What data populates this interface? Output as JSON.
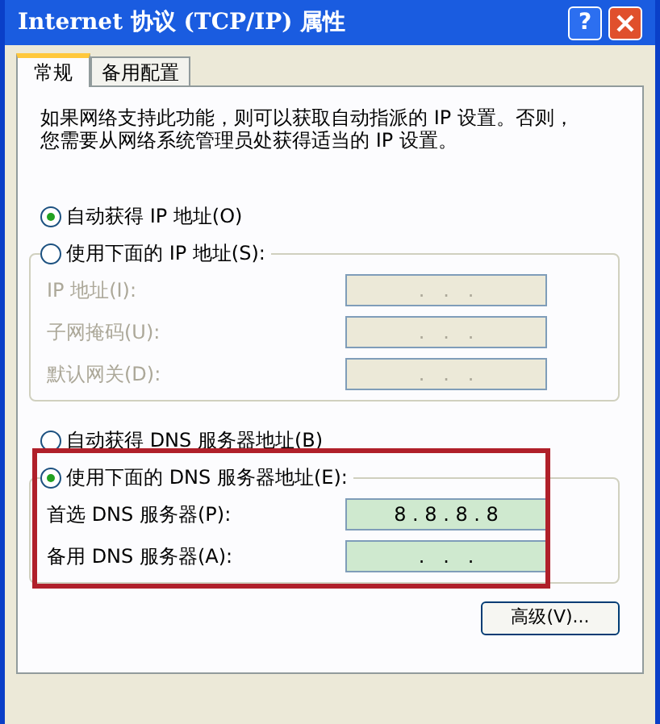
{
  "window": {
    "title": "Internet 协议 (TCP/IP) 属性",
    "help": "?"
  },
  "tabs": [
    {
      "label": "常规",
      "selected": true
    },
    {
      "label": "备用配置",
      "selected": false
    }
  ],
  "description": [
    "如果网络支持此功能，则可以获取自动指派的 IP 设置。否则，",
    "您需要从网络系统管理员处获得适当的 IP 设置。"
  ],
  "ip_section": {
    "auto_option": {
      "label": "自动获得 IP 地址(O)",
      "selected": true
    },
    "manual_option": {
      "label": "使用下面的 IP 地址(S):",
      "selected": false
    },
    "fields": [
      {
        "label": "IP 地址(I):",
        "value": ".   .   .",
        "disabled": true
      },
      {
        "label": "子网掩码(U):",
        "value": ".   .   .",
        "disabled": true
      },
      {
        "label": "默认网关(D):",
        "value": ".   .   .",
        "disabled": true
      }
    ]
  },
  "dns_section": {
    "auto_option": {
      "label": "自动获得 DNS 服务器地址(B)",
      "selected": false
    },
    "manual_option": {
      "label": "使用下面的 DNS 服务器地址(E):",
      "selected": true
    },
    "fields": [
      {
        "label": "首选 DNS 服务器(P):",
        "value": "8 . 8 . 8 . 8",
        "disabled": false
      },
      {
        "label": "备用 DNS 服务器(A):",
        "value": ".   .   .",
        "disabled": false
      }
    ]
  },
  "buttons": [
    "高级(V)..."
  ]
}
